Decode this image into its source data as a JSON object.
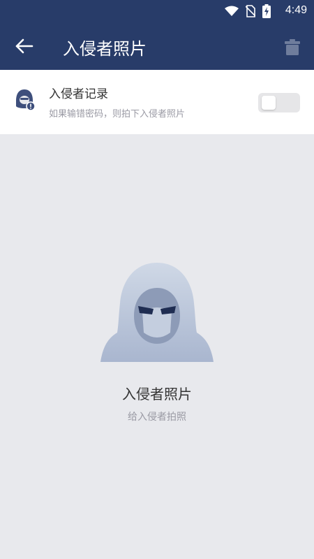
{
  "status_bar": {
    "time": "4:49",
    "icons": [
      "wifi-icon",
      "no-sim-icon",
      "battery-charging-icon"
    ]
  },
  "app_bar": {
    "title": "入侵者照片",
    "back_icon": "arrow-left-icon",
    "delete_icon": "trash-icon",
    "background_color": "#283c69"
  },
  "setting": {
    "title": "入侵者记录",
    "subtitle": "如果输错密码，则拍下入侵者照片",
    "enabled": false,
    "icon": "intruder-badge-icon"
  },
  "empty_state": {
    "title": "入侵者照片",
    "subtitle": "给入侵者拍照",
    "illustration": "hooded-intruder-illustration"
  }
}
